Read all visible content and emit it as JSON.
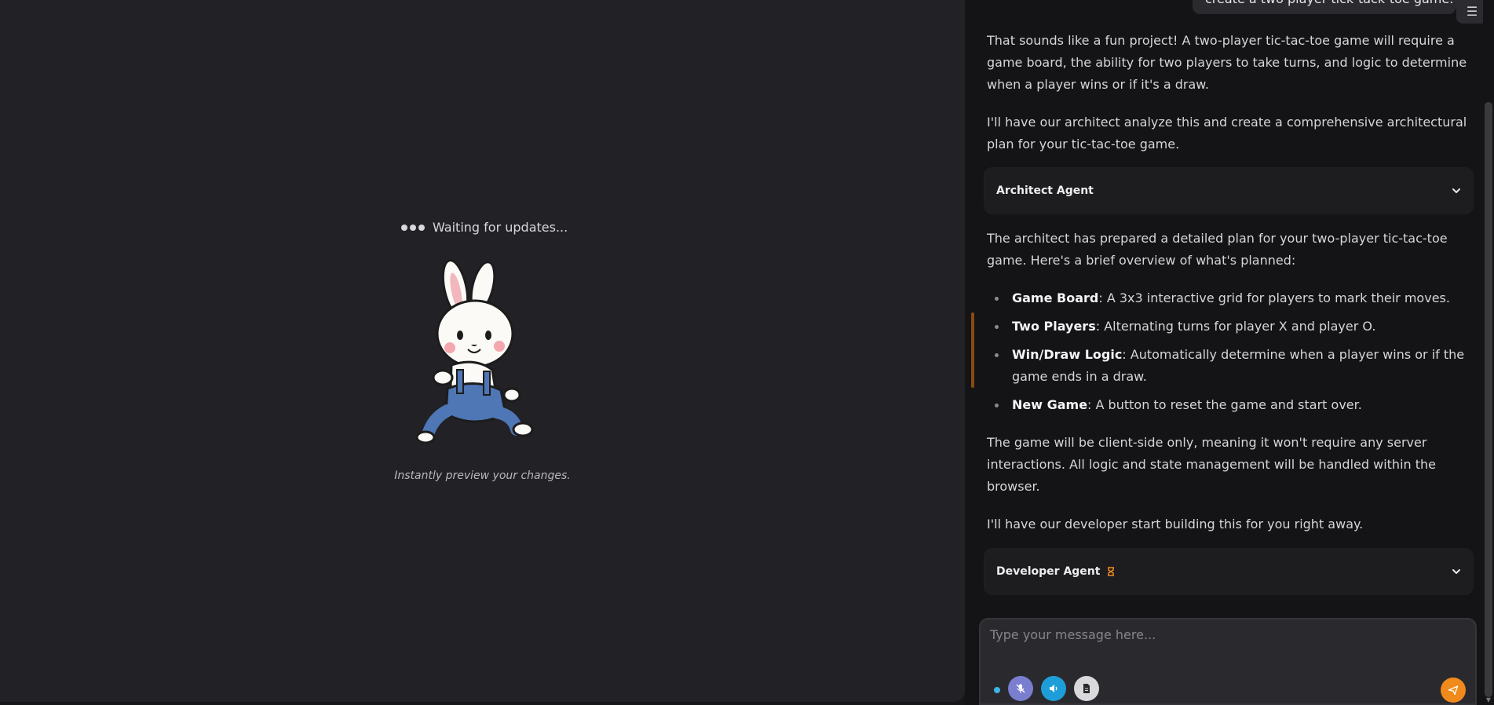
{
  "preview": {
    "waiting_text": "Waiting for updates...",
    "caption": "Instantly preview your changes."
  },
  "chat": {
    "user_message": "create a two player tick-tack-toe game.",
    "menu_glyph": "☰",
    "messages": {
      "m1": "That sounds like a fun project! A two-player tic-tac-toe game will require a game board, the ability for two players to take turns, and logic to determine when a player wins or if it's a draw.",
      "m2": "I'll have our architect analyze this and create a comprehensive architectural plan for your tic-tac-toe game.",
      "m3": "The architect has prepared a detailed plan for your two-player tic-tac-toe game. Here's a brief overview of what's planned:",
      "m4": "The game will be client-side only, meaning it won't require any server interactions. All logic and state management will be handled within the browser.",
      "m5": "I'll have our developer start building this for you right away."
    },
    "bullets": [
      {
        "title": "Game Board",
        "text": ": A 3x3 interactive grid for players to mark their moves."
      },
      {
        "title": "Two Players",
        "text": ": Alternating turns for player X and player O."
      },
      {
        "title": "Win/Draw Logic",
        "text": ": Automatically determine when a player wins or if the game ends in a draw."
      },
      {
        "title": "New Game",
        "text": ": A button to reset the game and start over."
      }
    ],
    "agents": {
      "architect": "Architect Agent",
      "developer": "Developer Agent"
    }
  },
  "composer": {
    "placeholder": "Type your message here..."
  },
  "colors": {
    "accent": "#f08a1d",
    "mic": "#7a7ecf",
    "speaker": "#1e9ed8",
    "status": "#3fb3e8"
  },
  "icons": {
    "mic": "mic-off-icon",
    "speaker": "speaker-icon",
    "file": "file-icon",
    "send": "send-icon",
    "chevron": "chevron-down-icon",
    "busy": "hourglass-icon",
    "menu": "menu-icon"
  }
}
